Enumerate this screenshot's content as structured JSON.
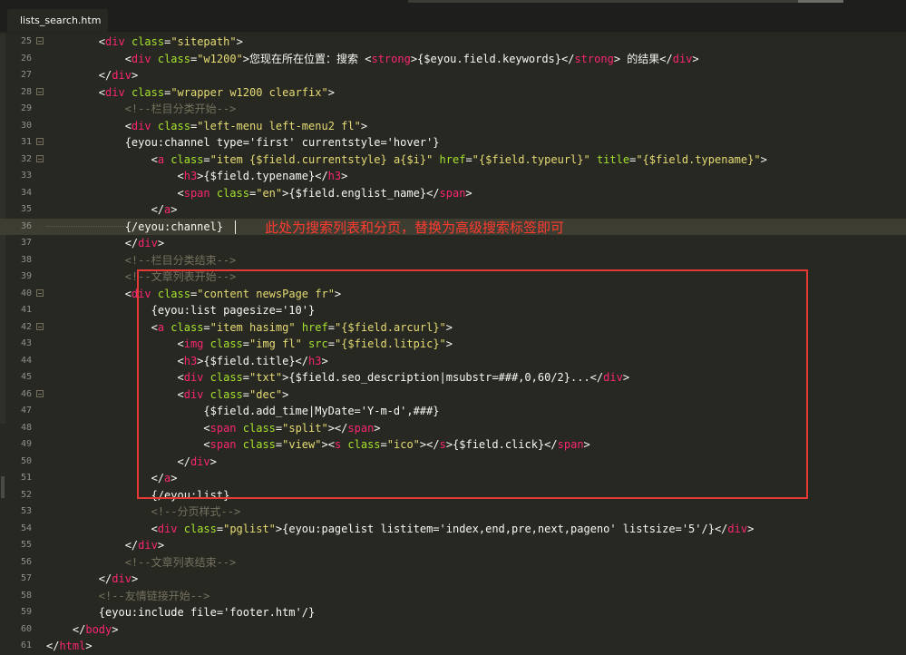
{
  "tab": {
    "title": "lists_search.htm"
  },
  "annotation": {
    "text": "此处为搜索列表和分页，替换为高级搜索标签即可"
  },
  "lines": [
    {
      "num": "25",
      "fold": true,
      "segs": [
        [
          "        ",
          ""
        ],
        [
          "<",
          ""
        ],
        [
          "div",
          "tg"
        ],
        [
          " ",
          ""
        ],
        [
          "class",
          "at"
        ],
        [
          "=",
          ""
        ],
        [
          "\"sitepath\"",
          "st"
        ],
        [
          ">",
          ""
        ]
      ]
    },
    {
      "num": "26",
      "fold": false,
      "segs": [
        [
          "            <",
          ""
        ],
        [
          "div",
          "tg"
        ],
        [
          " ",
          ""
        ],
        [
          "class",
          "at"
        ],
        [
          "=",
          ""
        ],
        [
          "\"w1200\"",
          "st"
        ],
        [
          ">您现在所在位置：搜索 <",
          ""
        ],
        [
          "strong",
          "tg"
        ],
        [
          ">{$eyou.field.keywords}</",
          ""
        ],
        [
          "strong",
          "tg"
        ],
        [
          "> 的结果</",
          ""
        ],
        [
          "div",
          "tg"
        ],
        [
          ">",
          ""
        ]
      ]
    },
    {
      "num": "27",
      "fold": false,
      "segs": [
        [
          "        </",
          ""
        ],
        [
          "div",
          "tg"
        ],
        [
          ">",
          ""
        ]
      ]
    },
    {
      "num": "28",
      "fold": true,
      "segs": [
        [
          "        <",
          ""
        ],
        [
          "div",
          "tg"
        ],
        [
          " ",
          ""
        ],
        [
          "class",
          "at"
        ],
        [
          "=",
          ""
        ],
        [
          "\"wrapper w1200 clearfix\"",
          "st"
        ],
        [
          ">",
          ""
        ]
      ]
    },
    {
      "num": "29",
      "fold": false,
      "segs": [
        [
          "            ",
          ""
        ],
        [
          "<!--栏目分类开始-->",
          "cm"
        ]
      ]
    },
    {
      "num": "30",
      "fold": false,
      "segs": [
        [
          "            <",
          ""
        ],
        [
          "div",
          "tg"
        ],
        [
          " ",
          ""
        ],
        [
          "class",
          "at"
        ],
        [
          "=",
          ""
        ],
        [
          "\"left-menu left-menu2 fl\"",
          "st"
        ],
        [
          ">",
          ""
        ]
      ]
    },
    {
      "num": "31",
      "fold": true,
      "segs": [
        [
          "            {eyou:channel type='first' currentstyle='hover'}",
          ""
        ]
      ]
    },
    {
      "num": "32",
      "fold": true,
      "segs": [
        [
          "                <",
          ""
        ],
        [
          "a",
          "tg"
        ],
        [
          " ",
          ""
        ],
        [
          "class",
          "at"
        ],
        [
          "=",
          ""
        ],
        [
          "\"item {$field.currentstyle} a{$i}\"",
          "st"
        ],
        [
          " ",
          ""
        ],
        [
          "href",
          "at"
        ],
        [
          "=",
          ""
        ],
        [
          "\"{$field.typeurl}\"",
          "st"
        ],
        [
          " ",
          ""
        ],
        [
          "title",
          "at"
        ],
        [
          "=",
          ""
        ],
        [
          "\"{$field.typename}\"",
          "st"
        ],
        [
          ">",
          ""
        ]
      ]
    },
    {
      "num": "33",
      "fold": false,
      "segs": [
        [
          "                    <",
          ""
        ],
        [
          "h3",
          "tg"
        ],
        [
          ">{$field.typename}</",
          ""
        ],
        [
          "h3",
          "tg"
        ],
        [
          ">",
          ""
        ]
      ]
    },
    {
      "num": "34",
      "fold": false,
      "segs": [
        [
          "                    <",
          ""
        ],
        [
          "span",
          "tg"
        ],
        [
          " ",
          ""
        ],
        [
          "class",
          "at"
        ],
        [
          "=",
          ""
        ],
        [
          "\"en\"",
          "st"
        ],
        [
          ">{$field.englist_name}</",
          ""
        ],
        [
          "span",
          "tg"
        ],
        [
          ">",
          ""
        ]
      ]
    },
    {
      "num": "35",
      "fold": false,
      "segs": [
        [
          "                </",
          ""
        ],
        [
          "a",
          "tg"
        ],
        [
          ">",
          ""
        ]
      ]
    },
    {
      "num": "36",
      "fold": false,
      "hl": true,
      "segs": [
        [
          "            {/eyou:channel}",
          ""
        ]
      ]
    },
    {
      "num": "37",
      "fold": false,
      "segs": [
        [
          "            </",
          ""
        ],
        [
          "div",
          "tg"
        ],
        [
          ">",
          ""
        ]
      ]
    },
    {
      "num": "38",
      "fold": false,
      "segs": [
        [
          "            ",
          ""
        ],
        [
          "<!--栏目分类结束-->",
          "cm"
        ]
      ]
    },
    {
      "num": "39",
      "fold": false,
      "segs": [
        [
          "            ",
          ""
        ],
        [
          "<!--文章列表开始-->",
          "cm"
        ]
      ]
    },
    {
      "num": "40",
      "fold": true,
      "segs": [
        [
          "            <",
          ""
        ],
        [
          "div",
          "tg"
        ],
        [
          " ",
          ""
        ],
        [
          "class",
          "at"
        ],
        [
          "=",
          ""
        ],
        [
          "\"content newsPage fr\"",
          "st"
        ],
        [
          ">",
          ""
        ]
      ]
    },
    {
      "num": "41",
      "fold": false,
      "segs": [
        [
          "                {eyou:list pagesize='10'}",
          ""
        ]
      ]
    },
    {
      "num": "42",
      "fold": true,
      "segs": [
        [
          "                <",
          ""
        ],
        [
          "a",
          "tg"
        ],
        [
          " ",
          ""
        ],
        [
          "class",
          "at"
        ],
        [
          "=",
          ""
        ],
        [
          "\"item hasimg\"",
          "st"
        ],
        [
          " ",
          ""
        ],
        [
          "href",
          "at"
        ],
        [
          "=",
          ""
        ],
        [
          "\"{$field.arcurl}\"",
          "st"
        ],
        [
          ">",
          ""
        ]
      ]
    },
    {
      "num": "43",
      "fold": false,
      "segs": [
        [
          "                    <",
          ""
        ],
        [
          "img",
          "tg"
        ],
        [
          " ",
          ""
        ],
        [
          "class",
          "at"
        ],
        [
          "=",
          ""
        ],
        [
          "\"img fl\"",
          "st"
        ],
        [
          " ",
          ""
        ],
        [
          "src",
          "at"
        ],
        [
          "=",
          ""
        ],
        [
          "\"{$field.litpic}\"",
          "st"
        ],
        [
          ">",
          ""
        ]
      ]
    },
    {
      "num": "44",
      "fold": false,
      "segs": [
        [
          "                    <",
          ""
        ],
        [
          "h3",
          "tg"
        ],
        [
          ">{$field.title}</",
          ""
        ],
        [
          "h3",
          "tg"
        ],
        [
          ">",
          ""
        ]
      ]
    },
    {
      "num": "45",
      "fold": false,
      "segs": [
        [
          "                    <",
          ""
        ],
        [
          "div",
          "tg"
        ],
        [
          " ",
          ""
        ],
        [
          "class",
          "at"
        ],
        [
          "=",
          ""
        ],
        [
          "\"txt\"",
          "st"
        ],
        [
          ">{$field.seo_description|msubstr=###,0,60/2}...</",
          ""
        ],
        [
          "div",
          "tg"
        ],
        [
          ">",
          ""
        ]
      ]
    },
    {
      "num": "46",
      "fold": true,
      "segs": [
        [
          "                    <",
          ""
        ],
        [
          "div",
          "tg"
        ],
        [
          " ",
          ""
        ],
        [
          "class",
          "at"
        ],
        [
          "=",
          ""
        ],
        [
          "\"dec\"",
          "st"
        ],
        [
          ">",
          ""
        ]
      ]
    },
    {
      "num": "47",
      "fold": false,
      "segs": [
        [
          "                        {$field.add_time|MyDate='Y-m-d',###}",
          ""
        ]
      ]
    },
    {
      "num": "48",
      "fold": false,
      "segs": [
        [
          "                        <",
          ""
        ],
        [
          "span",
          "tg"
        ],
        [
          " ",
          ""
        ],
        [
          "class",
          "at"
        ],
        [
          "=",
          ""
        ],
        [
          "\"split\"",
          "st"
        ],
        [
          "></",
          ""
        ],
        [
          "span",
          "tg"
        ],
        [
          ">",
          ""
        ]
      ]
    },
    {
      "num": "49",
      "fold": false,
      "segs": [
        [
          "                        <",
          ""
        ],
        [
          "span",
          "tg"
        ],
        [
          " ",
          ""
        ],
        [
          "class",
          "at"
        ],
        [
          "=",
          ""
        ],
        [
          "\"view\"",
          "st"
        ],
        [
          "><",
          ""
        ],
        [
          "s",
          "tg"
        ],
        [
          " ",
          ""
        ],
        [
          "class",
          "at"
        ],
        [
          "=",
          ""
        ],
        [
          "\"ico\"",
          "st"
        ],
        [
          "></",
          ""
        ],
        [
          "s",
          "tg"
        ],
        [
          ">{$field.click}</",
          ""
        ],
        [
          "span",
          "tg"
        ],
        [
          ">",
          ""
        ]
      ]
    },
    {
      "num": "50",
      "fold": false,
      "segs": [
        [
          "                    </",
          ""
        ],
        [
          "div",
          "tg"
        ],
        [
          ">",
          ""
        ]
      ]
    },
    {
      "num": "51",
      "fold": false,
      "segs": [
        [
          "                </",
          ""
        ],
        [
          "a",
          "tg"
        ],
        [
          ">",
          ""
        ]
      ]
    },
    {
      "num": "52",
      "fold": false,
      "segs": [
        [
          "                {/eyou:list}",
          ""
        ]
      ]
    },
    {
      "num": "53",
      "fold": false,
      "segs": [
        [
          "                ",
          ""
        ],
        [
          "<!--分页样式-->",
          "cm"
        ]
      ]
    },
    {
      "num": "54",
      "fold": false,
      "segs": [
        [
          "                <",
          ""
        ],
        [
          "div",
          "tg"
        ],
        [
          " ",
          ""
        ],
        [
          "class",
          "at"
        ],
        [
          "=",
          ""
        ],
        [
          "\"pglist\"",
          "st"
        ],
        [
          ">{eyou:pagelist listitem='index,end,pre,next,pageno' listsize='5'/}</",
          ""
        ],
        [
          "div",
          "tg"
        ],
        [
          ">",
          ""
        ]
      ]
    },
    {
      "num": "55",
      "fold": false,
      "segs": [
        [
          "            </",
          ""
        ],
        [
          "div",
          "tg"
        ],
        [
          ">",
          ""
        ]
      ]
    },
    {
      "num": "56",
      "fold": false,
      "segs": [
        [
          "            ",
          ""
        ],
        [
          "<!--文章列表结束-->",
          "cm"
        ]
      ]
    },
    {
      "num": "57",
      "fold": false,
      "segs": [
        [
          "        </",
          ""
        ],
        [
          "div",
          "tg"
        ],
        [
          ">",
          ""
        ]
      ]
    },
    {
      "num": "58",
      "fold": false,
      "segs": [
        [
          "        ",
          ""
        ],
        [
          "<!--友情链接开始-->",
          "cm"
        ]
      ]
    },
    {
      "num": "59",
      "fold": false,
      "segs": [
        [
          "        {eyou:include file='footer.htm'/}",
          ""
        ]
      ]
    },
    {
      "num": "60",
      "fold": false,
      "segs": [
        [
          "    </",
          ""
        ],
        [
          "body",
          "tg"
        ],
        [
          ">",
          ""
        ]
      ]
    },
    {
      "num": "61",
      "fold": false,
      "segs": [
        [
          "</",
          ""
        ],
        [
          "html",
          "tg"
        ],
        [
          ">",
          ""
        ]
      ]
    }
  ]
}
